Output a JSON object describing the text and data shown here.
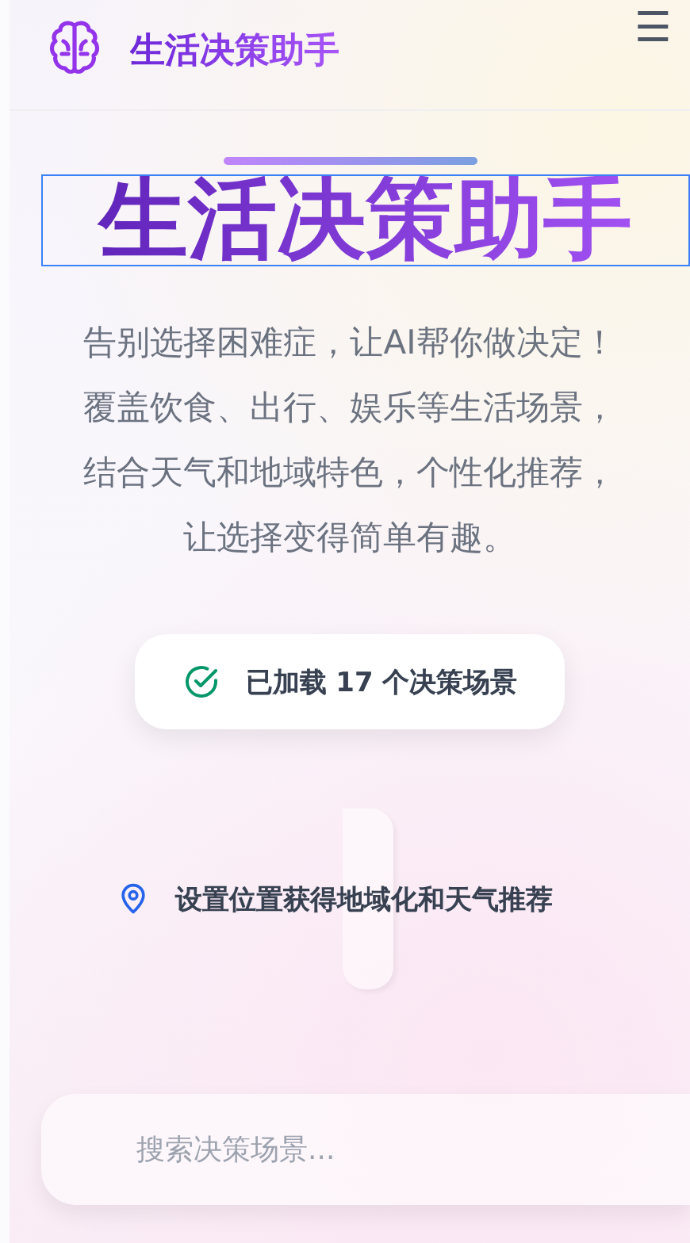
{
  "header": {
    "title": "生活决策助手",
    "menu_icon": "☰"
  },
  "hero": {
    "title": "生活决策助手",
    "subtitle_lines": [
      "告别选择困难症，让AI帮你做决定！",
      "覆盖饮食、出行、娱乐等生活场景，",
      "结合天气和地域特色，个性化推荐，",
      "让选择变得简单有趣。"
    ]
  },
  "status_badge": {
    "text": "已加载 17 个决策场景"
  },
  "location_prompt": {
    "text": "设置位置获得地域化和天气推荐"
  },
  "search": {
    "placeholder": "搜索决策场景..."
  }
}
